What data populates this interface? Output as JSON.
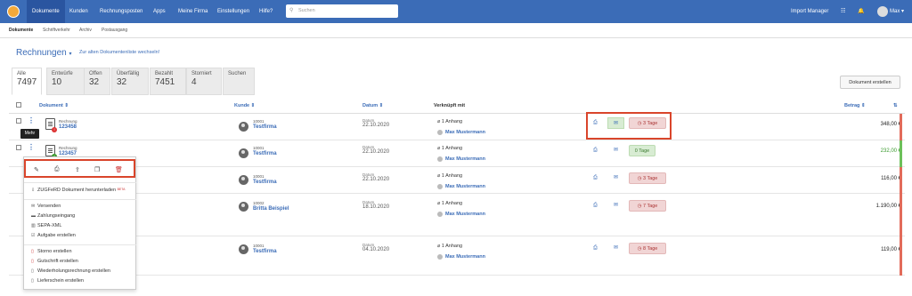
{
  "nav": {
    "items": [
      "Dokumente",
      "Kunden",
      "Rechnungsposten",
      "Apps",
      "Meine Firma",
      "Einstellungen",
      "Hilfe?"
    ],
    "search_placeholder": "Suchen",
    "import_manager": "Import Manager",
    "user": "Max"
  },
  "subnav": [
    "Dokumente",
    "Schriftverkehr",
    "Archiv",
    "Postausgang"
  ],
  "page": {
    "title": "Rechnungen",
    "link": "Zur alten Dokumentenliste wechseln!",
    "create_button": "Dokument erstellen"
  },
  "tabs": [
    {
      "label": "Alle",
      "count": "7497"
    },
    {
      "label": "Entwürfe",
      "count": "10"
    },
    {
      "label": "Offen",
      "count": "32"
    },
    {
      "label": "Überfällig",
      "count": "32"
    },
    {
      "label": "Bezahlt",
      "count": "7451"
    },
    {
      "label": "Storniert",
      "count": "4"
    },
    {
      "label": "Suchen",
      "count": ""
    }
  ],
  "columns": {
    "document": "Dokument",
    "customer": "Kunde",
    "date": "Datum",
    "linked": "Verknüpft mit",
    "amount": "Betrag"
  },
  "rows": [
    {
      "type": "Rechnung",
      "number": "123458",
      "cust_no": "10001",
      "customer": "Testfirma",
      "date_label": "Datum",
      "date": "22.10.2020",
      "attachments": "1 Anhang",
      "person": "Max Mustermann",
      "status": "3 Tage",
      "amount": "348,00 €"
    },
    {
      "type": "Rechnung",
      "number": "123457",
      "cust_no": "10001",
      "customer": "Testfirma",
      "date_label": "Datum",
      "date": "22.10.2020",
      "attachments": "1 Anhang",
      "person": "Max Mustermann",
      "status": "0 Tage",
      "amount": "232,00 €"
    },
    {
      "type": "",
      "number": "",
      "cust_no": "10001",
      "customer": "Testfirma",
      "date_label": "Datum",
      "date": "22.10.2020",
      "attachments": "1 Anhang",
      "person": "Max Mustermann",
      "status": "3 Tage",
      "amount": "116,00 €"
    },
    {
      "type": "",
      "number": "",
      "cust_no": "10002",
      "customer": "Britta Beispiel",
      "date_label": "Datum",
      "date": "18.10.2020",
      "attachments": "1 Anhang",
      "person": "Max Mustermann",
      "status": "7 Tage",
      "amount": "1.190,00 €"
    },
    {
      "type": "",
      "number": "",
      "cust_no": "10001",
      "customer": "Testfirma",
      "date_label": "Datum",
      "date": "04.10.2020",
      "attachments": "1 Anhang",
      "person": "Max Mustermann",
      "status": "8 Tage",
      "amount": "119,00 €"
    }
  ],
  "tooltip": "Mehr",
  "menu": {
    "zugferd": "ZUGFeRD Dokument herunterladen",
    "beta": "BETA",
    "group1": [
      "Versenden",
      "Zahlungseingang",
      "SEPA-XML",
      "Aufgabe erstellen"
    ],
    "group2": [
      "Storno erstellen",
      "Gutschrift erstellen",
      "Wiederholungsrechnung erstellen",
      "Lieferschein erstellen"
    ]
  },
  "colors": {
    "brand": "#3b6cb7",
    "highlight": "#d9452b",
    "overdue": "#f1d5d5",
    "ok": "#d8ecd3"
  }
}
